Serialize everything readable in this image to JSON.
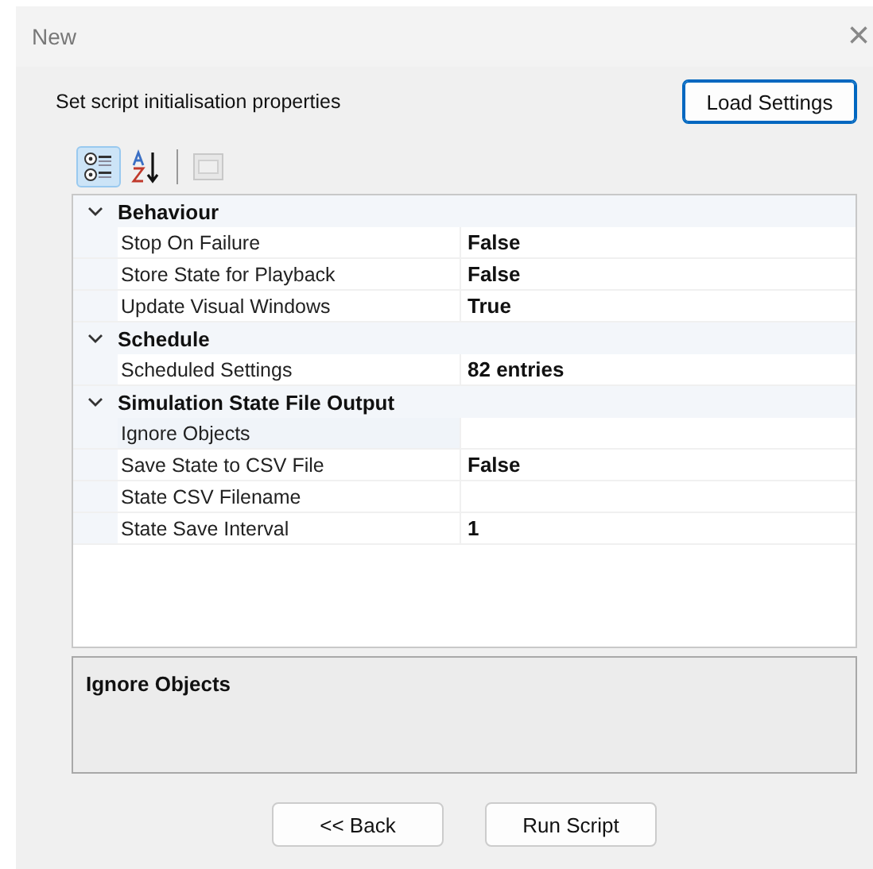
{
  "window": {
    "title": "New",
    "close": "×"
  },
  "header": {
    "caption": "Set script initialisation properties",
    "load_button": "Load Settings"
  },
  "toolbar": [
    {
      "kind": "categorized",
      "selected": true,
      "disabled": false
    },
    {
      "kind": "alphabetical",
      "selected": false,
      "disabled": false
    },
    {
      "kind": "pages",
      "selected": false,
      "disabled": true
    }
  ],
  "categories": [
    {
      "name": "Behaviour",
      "expanded": true,
      "properties": [
        {
          "name": "Stop On Failure",
          "value": "False",
          "selected": false
        },
        {
          "name": "Store State for Playback",
          "value": "False",
          "selected": false
        },
        {
          "name": "Update Visual Windows",
          "value": "True",
          "selected": false
        }
      ]
    },
    {
      "name": "Schedule",
      "expanded": true,
      "properties": [
        {
          "name": "Scheduled Settings",
          "value": "82 entries",
          "selected": false
        }
      ]
    },
    {
      "name": "Simulation State File Output",
      "expanded": true,
      "properties": [
        {
          "name": "Ignore Objects",
          "selected": true
        },
        {
          "name": "Save State to CSV File",
          "value": "False",
          "selected": false
        },
        {
          "name": "State CSV Filename",
          "selected": false
        },
        {
          "name": "State Save Interval",
          "value": "1",
          "selected": false
        }
      ]
    }
  ],
  "description": {
    "title": "Ignore Objects"
  },
  "buttons": [
    "<< Back",
    "Run Script"
  ]
}
